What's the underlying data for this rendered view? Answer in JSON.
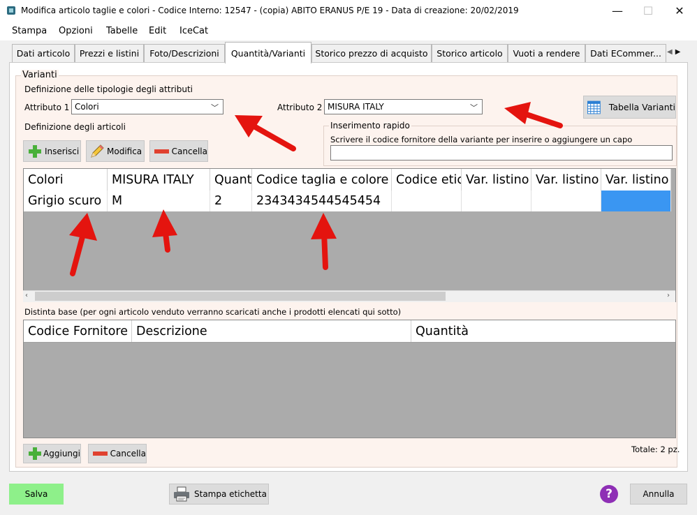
{
  "window": {
    "title": "Modifica articolo taglie e colori - Codice Interno: 12547 - (copia) ABITO ERANUS  P/E 19 - Data di creazione: 20/02/2019",
    "minimize": "—",
    "maximize": "☐",
    "close": "✕"
  },
  "menu": [
    "Stampa",
    "Opzioni",
    "Tabelle",
    "Edit",
    "IceCat"
  ],
  "tabs": [
    "Dati articolo",
    "Prezzi e listini",
    "Foto/Descrizioni",
    "Quantità/Varianti",
    "Storico prezzo di acquisto",
    "Storico articolo",
    "Vuoti a rendere",
    "Dati  ECommer..."
  ],
  "active_tab": "Quantità/Varianti",
  "varianti": {
    "group_title": "Varianti",
    "def_tipologie": "Definizione delle tipologie degli attributi",
    "attr1_label": "Attributo 1",
    "attr1_value": "Colori",
    "attr2_label": "Attributo 2",
    "attr2_value": "MISURA ITALY",
    "tabella_varianti": "Tabella Varianti",
    "def_articoli": "Definizione degli articoli",
    "inserisci": "Inserisci",
    "modifica": "Modifica",
    "cancella": "Cancella",
    "quick_title": "Inserimento rapido",
    "quick_hint": "Scrivere il codice fornitore della variante per inserire o aggiungere un capo",
    "quick_value": ""
  },
  "variants_table": {
    "columns": [
      "Colori",
      "MISURA ITALY",
      "Quant",
      "Codice taglia e colore f",
      "Codice etic",
      "Var. listino",
      "Var. listino",
      "Var. listino"
    ],
    "rows": [
      [
        "Grigio scuro",
        "M",
        "2",
        "2343434544545454",
        "",
        "",
        "",
        ""
      ]
    ]
  },
  "distinta": {
    "label": "Distinta base (per ogni articolo venduto verranno scaricati anche i prodotti elencati qui sotto)",
    "columns": [
      "Codice Fornitore",
      "Descrizione",
      "Quantità"
    ],
    "aggiungi": "Aggiungi",
    "cancella": "Cancella",
    "totale": "Totale: 2 pz."
  },
  "footer": {
    "salva": "Salva",
    "stampa_etichetta": "Stampa etichetta",
    "help": "?",
    "annulla": "Annulla"
  },
  "colors": {
    "salva_bg": "#8ef08a",
    "selection": "#3a96f2",
    "arrow": "#e4140f",
    "group_bg": "#fdf3ee"
  }
}
